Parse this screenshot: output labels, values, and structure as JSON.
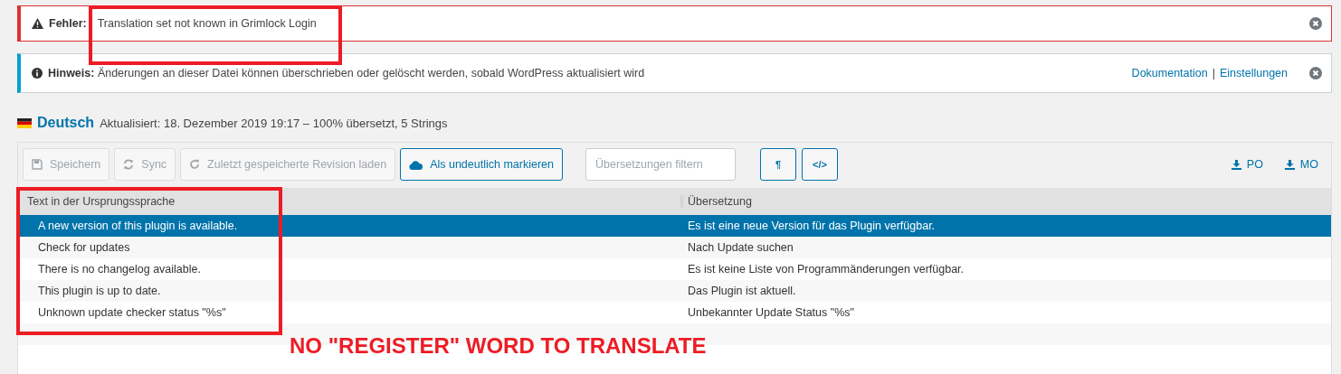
{
  "error_notice": {
    "label": "Fehler:",
    "message": "Translation set not known in Grimlock Login"
  },
  "info_notice": {
    "label": "Hinweis:",
    "message": "Änderungen an dieser Datei können überschrieben oder gelöscht werden, sobald WordPress aktualisiert wird",
    "links": [
      "Dokumentation",
      "Einstellungen"
    ],
    "separator": "|"
  },
  "heading": {
    "language": "Deutsch",
    "status": "Aktualisiert: 18. Dezember 2019 19:17 – 100% übersetzt, 5 Strings"
  },
  "toolbar": {
    "buttons": [
      {
        "label": "Speichern",
        "disabled": true
      },
      {
        "label": "Sync",
        "disabled": true
      },
      {
        "label": "Zuletzt gespeicherte Revision laden",
        "disabled": true
      },
      {
        "label": "Als undeutlich markieren",
        "disabled": false
      }
    ],
    "filter": {
      "placeholder": "Übersetzungen filtern"
    },
    "toggles": [
      "¶",
      "</>"
    ],
    "downloads": [
      "PO",
      "MO"
    ]
  },
  "table": {
    "columns": [
      "Text in der Ursprungssprache",
      "Übersetzung"
    ],
    "rows": [
      {
        "source": "A new version of this plugin is available.",
        "translation": "Es ist eine neue Version für das Plugin verfügbar.",
        "selected": true
      },
      {
        "source": "Check for updates",
        "translation": "Nach Update suchen",
        "selected": false
      },
      {
        "source": "There is no changelog available.",
        "translation": "Es ist keine Liste von Programmänderungen verfügbar.",
        "selected": false
      },
      {
        "source": "This plugin is up to date.",
        "translation": "Das Plugin ist aktuell.",
        "selected": false
      },
      {
        "source": "Unknown update checker status \"%s\"",
        "translation": "Unbekannter Update Status \"%s\"",
        "selected": false
      }
    ]
  },
  "annotation": {
    "text": "NO \"REGISTER\" WORD TO TRANSLATE"
  }
}
